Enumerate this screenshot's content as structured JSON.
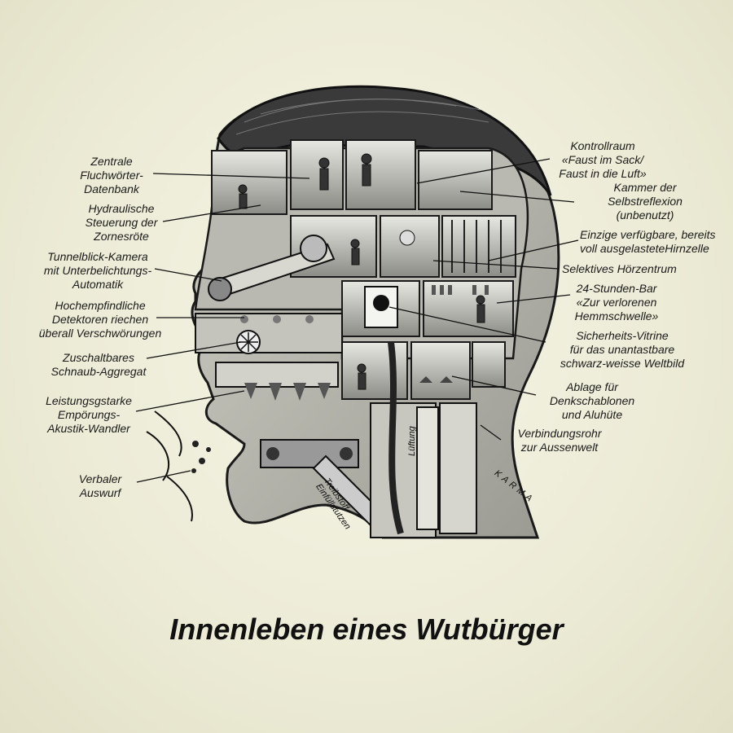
{
  "title": "Innenleben eines Wutbürger",
  "signature": "KARMA",
  "inner_labels": {
    "lueftung": "Lüftung",
    "treibstoff": "Treibstoff-\nEinfüllstutzen"
  },
  "labels_left": [
    {
      "id": "zentrale",
      "text": "Zentrale\nFluchwörter-\nDatenbank"
    },
    {
      "id": "hydraulische",
      "text": "Hydraulische\nSteuerung der\nZornesröte"
    },
    {
      "id": "tunnelblick",
      "text": "Tunnelblick-Kamera\nmit Unterbelichtungs-\nAutomatik"
    },
    {
      "id": "hochempfindliche",
      "text": "Hochempfindliche\nDetektoren riechen\nüberall Verschwörungen"
    },
    {
      "id": "zuschaltbares",
      "text": "Zuschaltbares\nSchnaub-Aggregat"
    },
    {
      "id": "leistungsstarke",
      "text": "Leistungsgstarke\nEmpörungs-\nAkustik-Wandler"
    },
    {
      "id": "verbaler",
      "text": "Verbaler\nAuswurf"
    }
  ],
  "labels_right": [
    {
      "id": "kontrollraum",
      "text": "Kontrollraum\n«Faust im Sack/\nFaust in die Luft»"
    },
    {
      "id": "kammer",
      "text": "Kammer der\nSelbstreflexion\n(unbenutzt)"
    },
    {
      "id": "einzige",
      "text": "Einzige verfügbare, bereits\nvoll ausgelasteteHirnzelle"
    },
    {
      "id": "selektives",
      "text": "Selektives Hörzentrum"
    },
    {
      "id": "bar",
      "text": "24-Stunden-Bar\n«Zur verlorenen\nHemmschwelle»"
    },
    {
      "id": "vitrine",
      "text": "Sicherheits-Vitrine\nfür das unantastbare\nschwarz-weisse Weltbild"
    },
    {
      "id": "ablage",
      "text": "Ablage für\nDenkschablonen\nund Aluhüte"
    },
    {
      "id": "verbindungsrohr",
      "text": "Verbindungsrohr\nzur Aussenwelt"
    }
  ]
}
